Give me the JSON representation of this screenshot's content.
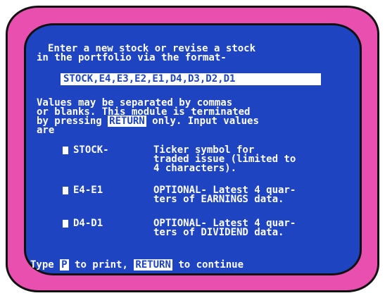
{
  "intro": {
    "line1": "Enter a new stock or revise a stock",
    "line2": "in the portfolio via the format-"
  },
  "format": "STOCK,E4,E3,E2,E1,D4,D3,D2,D1",
  "note": {
    "line1": "Values may be separated by commas",
    "line2": "or blanks. This module is terminated",
    "line3_pre": "by pressing ",
    "line3_key": "RETURN",
    "line3_post": " only. Input values",
    "line4": "are"
  },
  "items": [
    {
      "label": "STOCK-",
      "desc1": "Ticker symbol for",
      "desc2": "traded issue (limited to",
      "desc3": "4 characters)."
    },
    {
      "label": "E4-E1",
      "desc1": "OPTIONAL- Latest 4 quar-",
      "desc2": "ters of EARNINGS data."
    },
    {
      "label": "D4-D1",
      "desc1": "OPTIONAL- Latest 4 quar-",
      "desc2": "ters of DIVIDEND data."
    }
  ],
  "footer": {
    "pre": "Type ",
    "p_key": "P",
    "mid": " to print, ",
    "return_key": "RETURN",
    "post": " to continue"
  },
  "colors": {
    "bezel": "#e84fae",
    "screen": "#1e44c2",
    "text": "#ffffff"
  }
}
